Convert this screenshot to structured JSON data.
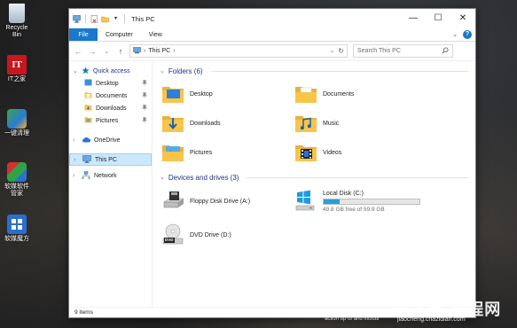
{
  "desktop": {
    "icons": [
      {
        "label": "Recycle Bin"
      },
      {
        "label": "IT之家",
        "glyph": "IT"
      },
      {
        "label": "一键清理"
      },
      {
        "label": "软媒软件管家"
      },
      {
        "label": "软媒魔方"
      }
    ],
    "watermark": "查字典 教程网",
    "watermark_sub": "jiaocheng.chazidian.com",
    "background_text": "action up to and includi"
  },
  "window": {
    "title": "This PC",
    "controls": {
      "minimize": "—",
      "maximize": "☐",
      "close": "✕"
    },
    "ribbon_tabs": [
      "File",
      "Computer",
      "View"
    ],
    "ribbon_expand": "⌄",
    "help": "?",
    "nav_buttons": {
      "back": "←",
      "forward": "→",
      "recent": "⌄",
      "up": "↑"
    },
    "address": {
      "separator1": "›",
      "location": "This PC",
      "separator2": "›",
      "dropdown": "⌄",
      "refresh": "↻"
    },
    "search": {
      "placeholder": "Search This PC",
      "icon": "search-icon"
    },
    "nav_pane": {
      "quick_access": "Quick access",
      "quick_items": [
        "Desktop",
        "Documents",
        "Downloads",
        "Pictures"
      ],
      "pin": "📌",
      "onedrive": "OneDrive",
      "this_pc": "This PC",
      "network": "Network",
      "chevron": "›",
      "chevron_open": "⌄"
    },
    "content": {
      "folders_header": "Folders (6)",
      "folders": [
        "Desktop",
        "Documents",
        "Downloads",
        "Music",
        "Pictures",
        "Videos"
      ],
      "drives_header": "Devices and drives (3)",
      "drives": [
        {
          "name": "Floppy Disk Drive (A:)"
        },
        {
          "name": "Local Disk (C:)",
          "free_text": "49.8 GB free of 59.9 GB",
          "used_fraction": 0.17
        },
        {
          "name": "DVD Drive (D:)",
          "badge": "DVD"
        }
      ]
    },
    "status": "9 items"
  },
  "colors": {
    "accent": "#1979ca",
    "header_text": "#1e3287",
    "selection_bg": "#cce8ff",
    "capacity_fill": "#26a0da",
    "folder_yellow": "#f8c549"
  }
}
